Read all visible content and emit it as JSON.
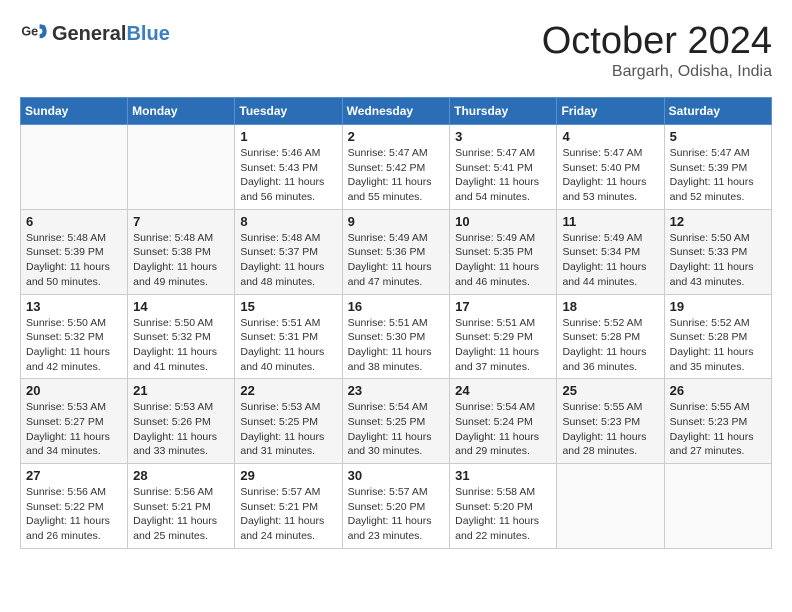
{
  "header": {
    "logo_general": "General",
    "logo_blue": "Blue",
    "month_title": "October 2024",
    "location": "Bargarh, Odisha, India"
  },
  "weekdays": [
    "Sunday",
    "Monday",
    "Tuesday",
    "Wednesday",
    "Thursday",
    "Friday",
    "Saturday"
  ],
  "weeks": [
    [
      {
        "day": "",
        "info": ""
      },
      {
        "day": "",
        "info": ""
      },
      {
        "day": "1",
        "info": "Sunrise: 5:46 AM\nSunset: 5:43 PM\nDaylight: 11 hours and 56 minutes."
      },
      {
        "day": "2",
        "info": "Sunrise: 5:47 AM\nSunset: 5:42 PM\nDaylight: 11 hours and 55 minutes."
      },
      {
        "day": "3",
        "info": "Sunrise: 5:47 AM\nSunset: 5:41 PM\nDaylight: 11 hours and 54 minutes."
      },
      {
        "day": "4",
        "info": "Sunrise: 5:47 AM\nSunset: 5:40 PM\nDaylight: 11 hours and 53 minutes."
      },
      {
        "day": "5",
        "info": "Sunrise: 5:47 AM\nSunset: 5:39 PM\nDaylight: 11 hours and 52 minutes."
      }
    ],
    [
      {
        "day": "6",
        "info": "Sunrise: 5:48 AM\nSunset: 5:39 PM\nDaylight: 11 hours and 50 minutes."
      },
      {
        "day": "7",
        "info": "Sunrise: 5:48 AM\nSunset: 5:38 PM\nDaylight: 11 hours and 49 minutes."
      },
      {
        "day": "8",
        "info": "Sunrise: 5:48 AM\nSunset: 5:37 PM\nDaylight: 11 hours and 48 minutes."
      },
      {
        "day": "9",
        "info": "Sunrise: 5:49 AM\nSunset: 5:36 PM\nDaylight: 11 hours and 47 minutes."
      },
      {
        "day": "10",
        "info": "Sunrise: 5:49 AM\nSunset: 5:35 PM\nDaylight: 11 hours and 46 minutes."
      },
      {
        "day": "11",
        "info": "Sunrise: 5:49 AM\nSunset: 5:34 PM\nDaylight: 11 hours and 44 minutes."
      },
      {
        "day": "12",
        "info": "Sunrise: 5:50 AM\nSunset: 5:33 PM\nDaylight: 11 hours and 43 minutes."
      }
    ],
    [
      {
        "day": "13",
        "info": "Sunrise: 5:50 AM\nSunset: 5:32 PM\nDaylight: 11 hours and 42 minutes."
      },
      {
        "day": "14",
        "info": "Sunrise: 5:50 AM\nSunset: 5:32 PM\nDaylight: 11 hours and 41 minutes."
      },
      {
        "day": "15",
        "info": "Sunrise: 5:51 AM\nSunset: 5:31 PM\nDaylight: 11 hours and 40 minutes."
      },
      {
        "day": "16",
        "info": "Sunrise: 5:51 AM\nSunset: 5:30 PM\nDaylight: 11 hours and 38 minutes."
      },
      {
        "day": "17",
        "info": "Sunrise: 5:51 AM\nSunset: 5:29 PM\nDaylight: 11 hours and 37 minutes."
      },
      {
        "day": "18",
        "info": "Sunrise: 5:52 AM\nSunset: 5:28 PM\nDaylight: 11 hours and 36 minutes."
      },
      {
        "day": "19",
        "info": "Sunrise: 5:52 AM\nSunset: 5:28 PM\nDaylight: 11 hours and 35 minutes."
      }
    ],
    [
      {
        "day": "20",
        "info": "Sunrise: 5:53 AM\nSunset: 5:27 PM\nDaylight: 11 hours and 34 minutes."
      },
      {
        "day": "21",
        "info": "Sunrise: 5:53 AM\nSunset: 5:26 PM\nDaylight: 11 hours and 33 minutes."
      },
      {
        "day": "22",
        "info": "Sunrise: 5:53 AM\nSunset: 5:25 PM\nDaylight: 11 hours and 31 minutes."
      },
      {
        "day": "23",
        "info": "Sunrise: 5:54 AM\nSunset: 5:25 PM\nDaylight: 11 hours and 30 minutes."
      },
      {
        "day": "24",
        "info": "Sunrise: 5:54 AM\nSunset: 5:24 PM\nDaylight: 11 hours and 29 minutes."
      },
      {
        "day": "25",
        "info": "Sunrise: 5:55 AM\nSunset: 5:23 PM\nDaylight: 11 hours and 28 minutes."
      },
      {
        "day": "26",
        "info": "Sunrise: 5:55 AM\nSunset: 5:23 PM\nDaylight: 11 hours and 27 minutes."
      }
    ],
    [
      {
        "day": "27",
        "info": "Sunrise: 5:56 AM\nSunset: 5:22 PM\nDaylight: 11 hours and 26 minutes."
      },
      {
        "day": "28",
        "info": "Sunrise: 5:56 AM\nSunset: 5:21 PM\nDaylight: 11 hours and 25 minutes."
      },
      {
        "day": "29",
        "info": "Sunrise: 5:57 AM\nSunset: 5:21 PM\nDaylight: 11 hours and 24 minutes."
      },
      {
        "day": "30",
        "info": "Sunrise: 5:57 AM\nSunset: 5:20 PM\nDaylight: 11 hours and 23 minutes."
      },
      {
        "day": "31",
        "info": "Sunrise: 5:58 AM\nSunset: 5:20 PM\nDaylight: 11 hours and 22 minutes."
      },
      {
        "day": "",
        "info": ""
      },
      {
        "day": "",
        "info": ""
      }
    ]
  ]
}
